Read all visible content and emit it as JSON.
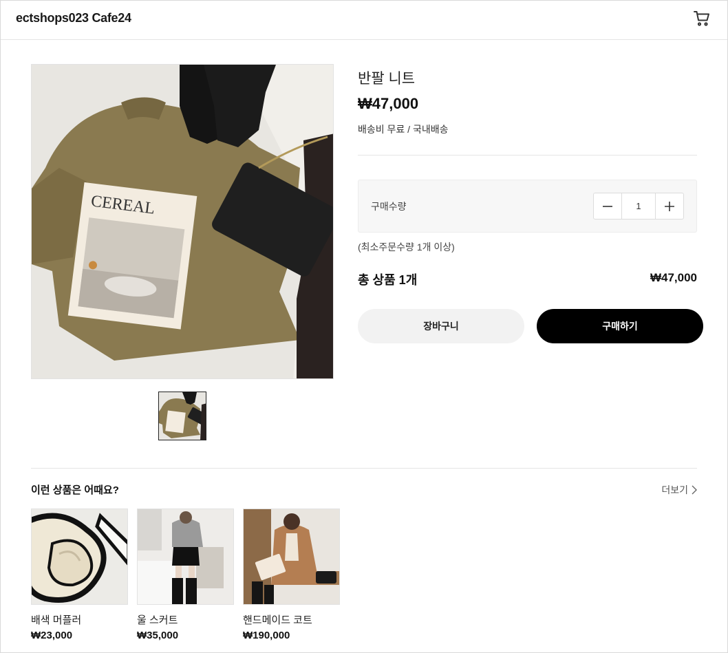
{
  "header": {
    "brand": "ectshops023 Cafe24",
    "cart_icon": "cart-icon"
  },
  "product": {
    "name": "반팔 니트",
    "price": "₩47,000",
    "shipping": "배송비 무료 / 국내배송",
    "quantity_label": "구매수량",
    "quantity": "1",
    "min_order": "(최소주문수량 1개 이상)",
    "total_label": "총 상품 1개",
    "total_price": "₩47,000",
    "cart_button": "장바구니",
    "buy_button": "구매하기"
  },
  "recommend": {
    "title": "이런 상품은 어때요?",
    "more": "더보기",
    "items": [
      {
        "name": "배색 머플러",
        "price": "₩23,000"
      },
      {
        "name": "울 스커트",
        "price": "₩35,000"
      },
      {
        "name": "핸드메이드 코트",
        "price": "₩190,000"
      }
    ]
  },
  "colors": {
    "accent": "#000000",
    "button_light": "#f2f2f2",
    "panel": "#f7f7f7"
  }
}
